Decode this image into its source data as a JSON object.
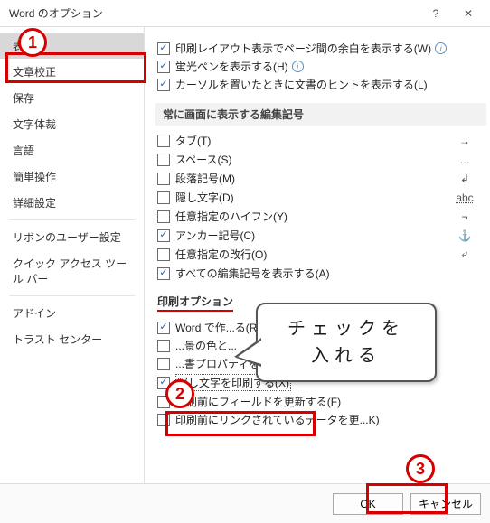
{
  "window": {
    "title": "Word のオプション"
  },
  "sidebar": {
    "items": [
      {
        "label": "表示",
        "selected": true
      },
      {
        "label": "文章校正"
      },
      {
        "label": "保存"
      },
      {
        "label": "文字体裁"
      },
      {
        "label": "言語"
      },
      {
        "label": "簡単操作"
      },
      {
        "label": "詳細設定"
      },
      {
        "label": "リボンのユーザー設定"
      },
      {
        "label": "クイック アクセス ツール バー"
      },
      {
        "label": "アドイン"
      },
      {
        "label": "トラスト センター"
      }
    ]
  },
  "top_checks": [
    {
      "label": "印刷レイアウト表示でページ間の余白を表示する(W)",
      "checked": true,
      "info": true
    },
    {
      "label": "蛍光ペンを表示する(H)",
      "checked": true,
      "info": true
    },
    {
      "label": "カーソルを置いたときに文書のヒントを表示する(L)",
      "checked": true,
      "info": false
    }
  ],
  "mark_section": {
    "header": "常に画面に表示する編集記号"
  },
  "marks": [
    {
      "label": "タブ(T)",
      "checked": false,
      "sym": "→"
    },
    {
      "label": "スペース(S)",
      "checked": false,
      "sym": "…"
    },
    {
      "label": "段落記号(M)",
      "checked": false,
      "sym": "↲"
    },
    {
      "label": "隠し文字(D)",
      "checked": false,
      "sym": "abc"
    },
    {
      "label": "任意指定のハイフン(Y)",
      "checked": false,
      "sym": "¬"
    },
    {
      "label": "アンカー記号(C)",
      "checked": true,
      "sym": "⚓"
    },
    {
      "label": "任意指定の改行(O)",
      "checked": false,
      "sym": "⤶"
    },
    {
      "label": "すべての編集記号を表示する(A)",
      "checked": true,
      "sym": ""
    }
  ],
  "print_section": {
    "header": "印刷オプション"
  },
  "print_opts": [
    {
      "label": "Word で作...る(R)",
      "checked": true
    },
    {
      "label": "...景の色と...",
      "checked": false
    },
    {
      "label": "...書プロパティを印刷す...",
      "checked": false
    },
    {
      "label": "隠し文字を印刷する(X)",
      "checked": true,
      "highlight": true
    },
    {
      "label": "印刷前にフィールドを更新する(F)",
      "checked": false
    },
    {
      "label": "印刷前にリンクされているデータを更...K)",
      "checked": false
    }
  ],
  "buttons": {
    "ok": "OK",
    "cancel": "キャンセル"
  },
  "annotations": {
    "n1": "1",
    "n2": "2",
    "n3": "3",
    "callout_l1": "チェックを",
    "callout_l2": "入れる"
  }
}
